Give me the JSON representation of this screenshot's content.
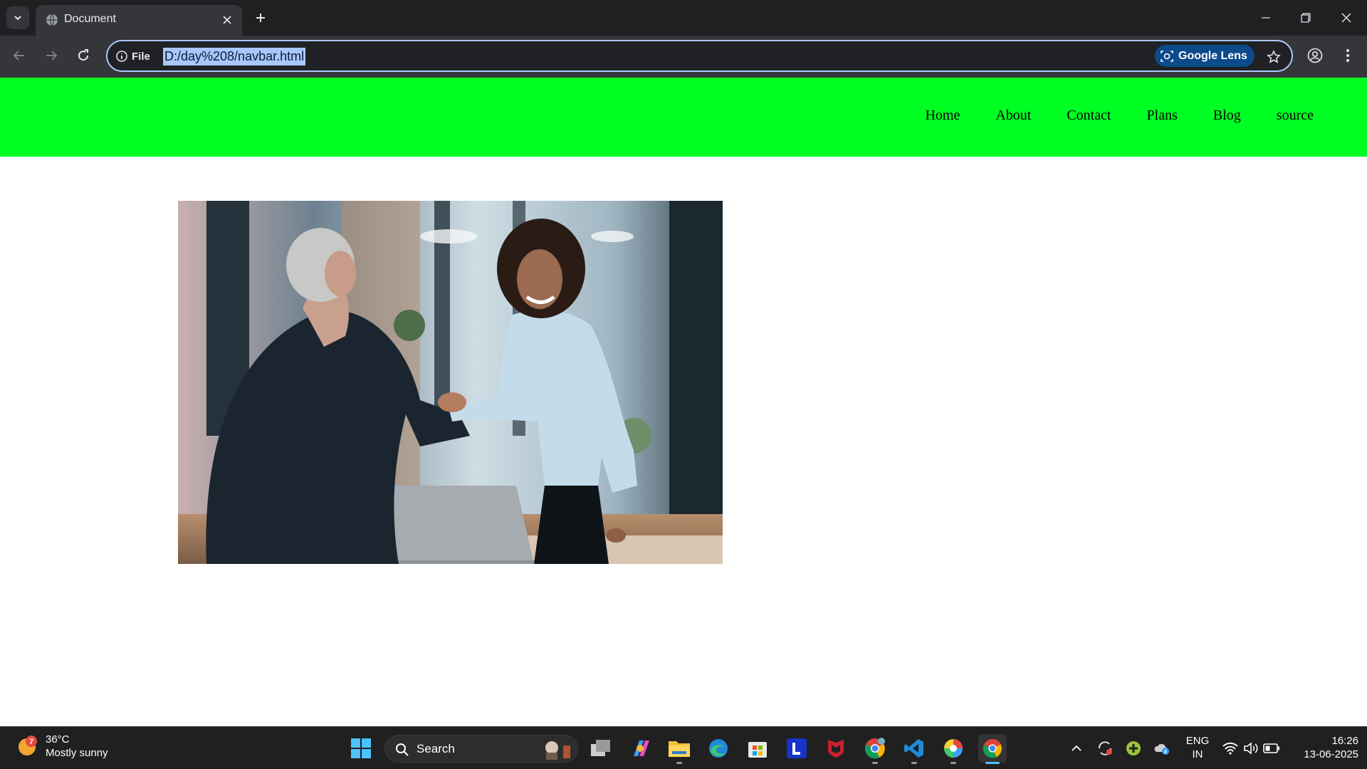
{
  "browser": {
    "tab": {
      "title": "Document"
    },
    "address": {
      "site_info_label": "File",
      "url": "D:/day%208/navbar.html",
      "lens_label": "Google Lens"
    }
  },
  "navbar": {
    "items": [
      {
        "label": "Home"
      },
      {
        "label": "About"
      },
      {
        "label": "Contact"
      },
      {
        "label": "Plans"
      },
      {
        "label": "Blog"
      },
      {
        "label": "source"
      }
    ],
    "background": "#00ff23"
  },
  "taskbar": {
    "weather": {
      "temperature": "36°C",
      "condition": "Mostly sunny",
      "badge": "7"
    },
    "search_label": "Search",
    "language": {
      "line1": "ENG",
      "line2": "IN"
    },
    "clock": {
      "time": "16:26",
      "date": "13-06-2025"
    },
    "apps": [
      "windows-start",
      "task-view",
      "copilot",
      "file-explorer",
      "edge",
      "microsoft-store",
      "l-app",
      "mcafee",
      "chrome-profile",
      "vscode",
      "photos",
      "chrome"
    ]
  }
}
